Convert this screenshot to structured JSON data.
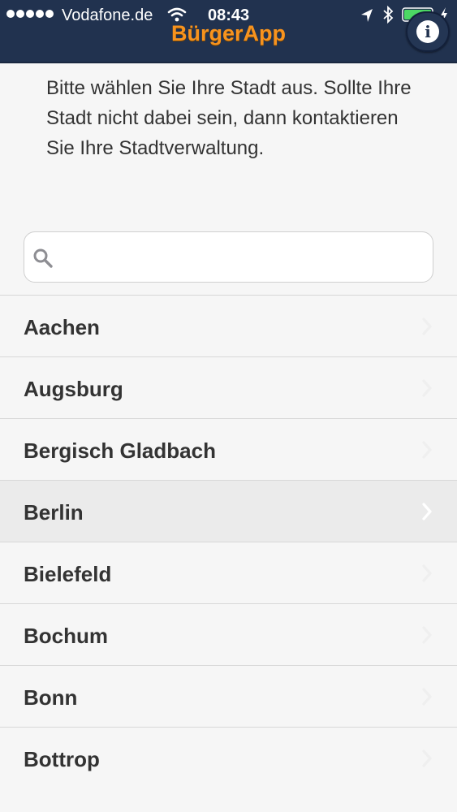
{
  "status_bar": {
    "carrier": "Vodafone.de",
    "time": "08:43"
  },
  "header": {
    "title": "BürgerApp",
    "info_label": "i"
  },
  "intro_text": "Bitte wählen Sie Ihre Stadt aus. Sollte Ihre Stadt nicht dabei sein, dann kontaktieren Sie Ihre Stadtverwaltung.",
  "search": {
    "value": "",
    "placeholder": ""
  },
  "cities": [
    {
      "name": "Aachen"
    },
    {
      "name": "Augsburg"
    },
    {
      "name": "Bergisch Gladbach"
    },
    {
      "name": "Berlin",
      "selected": true
    },
    {
      "name": "Bielefeld"
    },
    {
      "name": "Bochum"
    },
    {
      "name": "Bonn"
    },
    {
      "name": "Bottrop"
    }
  ],
  "colors": {
    "header_bg": "#21324f",
    "title_accent": "#f7931e",
    "battery_green": "#4cd964"
  }
}
